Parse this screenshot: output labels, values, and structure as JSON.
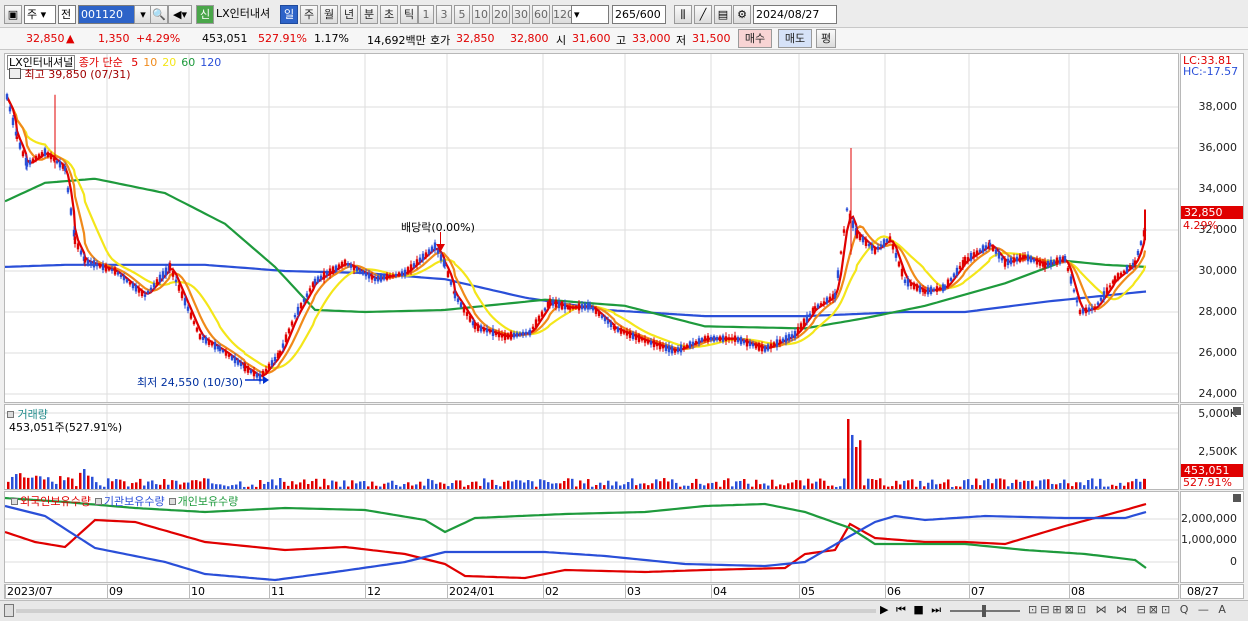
{
  "toolbar": {
    "type_select": "주",
    "kind_select": "전",
    "code": "001120",
    "badge": "신",
    "name": "LX인터내셔",
    "period_tabs": [
      "일",
      "주",
      "월",
      "년",
      "분",
      "초",
      "틱"
    ],
    "active_tab": "일",
    "minute_tabs": [
      "1",
      "3",
      "5",
      "10",
      "20",
      "30",
      "60",
      "120"
    ],
    "count": "265",
    "count_total": "/600",
    "date": "2024/08/27"
  },
  "quote": {
    "price": "32,850",
    "arrow": "▲",
    "change": "1,350",
    "change_pct": "+4.29%",
    "volume": "453,051",
    "volume_ratio": "527.91%",
    "turnover": "1.17%",
    "amount": "14,692백만",
    "ask_label": "호가",
    "ask": "32,850",
    "bid": "32,800",
    "open_label": "시",
    "open": "31,600",
    "high_label": "고",
    "high": "33,000",
    "low_label": "저",
    "low": "31,500",
    "buy_button": "매수",
    "sell_button": "매도",
    "eval_button": "평"
  },
  "price_panel": {
    "legend_name": "LX인터내셔널",
    "legend_ma_label": "종가 단순",
    "ma_periods": [
      "5",
      "10",
      "20",
      "60",
      "120"
    ],
    "ma_colors": [
      "#e00000",
      "#f08a1a",
      "#f4e61a",
      "#1e9a3c",
      "#2a4fd8"
    ],
    "max_label": "최고 39,850 (07/31)",
    "min_label": "최저 24,550 (10/30)",
    "dividend_label": "배당락(0.00%)",
    "lc": "LC:33.81",
    "hc": "HC:-17.57",
    "y_ticks": [
      "38,000",
      "36,000",
      "34,000",
      "32,000",
      "30,000",
      "28,000",
      "26,000",
      "24,000"
    ],
    "last_price_tag": "32,850",
    "last_pct_tag": "4.29%"
  },
  "volume_panel": {
    "title": "거래량",
    "summary": "453,051주(527.91%)",
    "y_ticks": [
      "5,000K",
      "2,500K"
    ],
    "tag": "453,051",
    "tag_pct": "527.91%"
  },
  "holdings_panel": {
    "legend": [
      "외국인보유수량",
      "기관보유수량",
      "개인보유수량"
    ],
    "colors": [
      "#e00000",
      "#2a4fd8",
      "#1e9a3c"
    ],
    "y_ticks": [
      "2,000,000",
      "1,000,000",
      "0"
    ]
  },
  "x_axis": {
    "labels": [
      "2023/07",
      "09",
      "10",
      "11",
      "12",
      "2024/01",
      "02",
      "03",
      "04",
      "05",
      "06",
      "07",
      "08"
    ],
    "right_label": "08/27"
  }
}
